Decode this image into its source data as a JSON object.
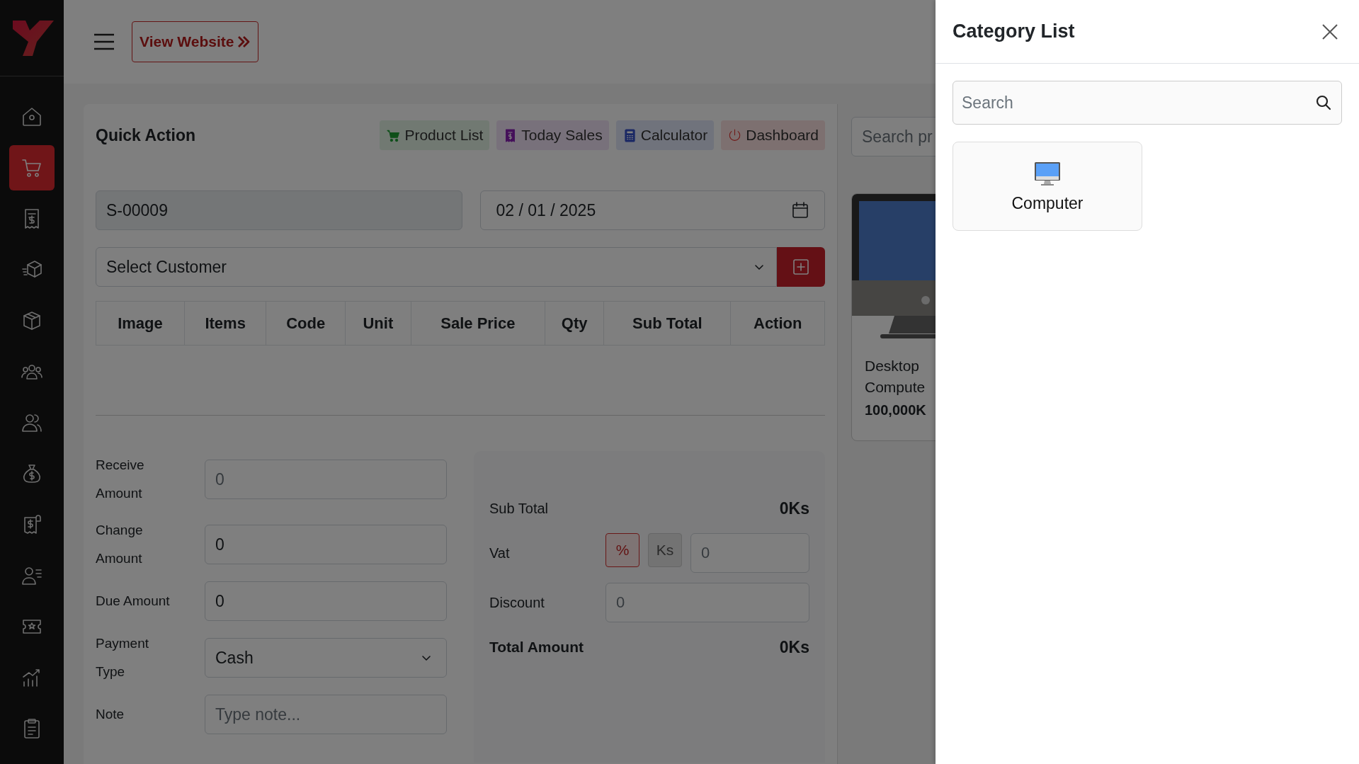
{
  "topbar": {
    "view_website": "View Website"
  },
  "sidebar": {
    "items": [
      {
        "kind": "home",
        "selected": false
      },
      {
        "kind": "cart",
        "selected": true
      },
      {
        "kind": "receipt",
        "selected": false
      },
      {
        "kind": "box-fast",
        "selected": false
      },
      {
        "kind": "box",
        "selected": false
      },
      {
        "kind": "group",
        "selected": false
      },
      {
        "kind": "users",
        "selected": false
      },
      {
        "kind": "money-bag",
        "selected": false
      },
      {
        "kind": "bill",
        "selected": false
      },
      {
        "kind": "user-list",
        "selected": false
      },
      {
        "kind": "ticket",
        "selected": false
      },
      {
        "kind": "chart",
        "selected": false
      },
      {
        "kind": "clipboard",
        "selected": false
      }
    ]
  },
  "quick_action": {
    "title": "Quick Action",
    "buttons": [
      {
        "label": "Product List",
        "kind": "cart"
      },
      {
        "label": "Today Sales",
        "kind": "receipt"
      },
      {
        "label": "Calculator",
        "kind": "calculator"
      },
      {
        "label": "Dashboard",
        "kind": "power"
      }
    ]
  },
  "sale_form": {
    "invoice_no": "S-00009",
    "date": "02 / 01 / 2025",
    "customer": "Select Customer"
  },
  "items_table": {
    "columns": [
      "Image",
      "Items",
      "Code",
      "Unit",
      "Sale Price",
      "Qty",
      "Sub Total",
      "Action"
    ]
  },
  "payment": {
    "fields": [
      {
        "label": "Receive Amount",
        "kind": "input",
        "placeholder": "0"
      },
      {
        "label": "Change Amount",
        "kind": "input",
        "value": "0"
      },
      {
        "label": "Due Amount",
        "kind": "input",
        "value": "0"
      },
      {
        "label": "Payment Type",
        "kind": "select",
        "value": "Cash"
      },
      {
        "label": "Note",
        "kind": "input",
        "placeholder": "Type note..."
      }
    ]
  },
  "summary": {
    "sub_total": {
      "label": "Sub Total",
      "value": "0Ks"
    },
    "vat": {
      "label": "Vat",
      "modes": [
        {
          "label": "%",
          "selected": true
        },
        {
          "label": "Ks",
          "selected": false
        }
      ],
      "placeholder": "0"
    },
    "discount": {
      "label": "Discount",
      "placeholder": "0"
    },
    "total": {
      "label": "Total Amount",
      "value": "0Ks"
    }
  },
  "product_panel": {
    "search": {
      "placeholder": "Search pr"
    },
    "products": [
      {
        "name": "Desktop Compute",
        "price": "100,000K"
      }
    ]
  },
  "drawer": {
    "title": "Category List",
    "search": {
      "placeholder": "Search"
    },
    "categories": [
      {
        "name": "Computer"
      }
    ]
  }
}
